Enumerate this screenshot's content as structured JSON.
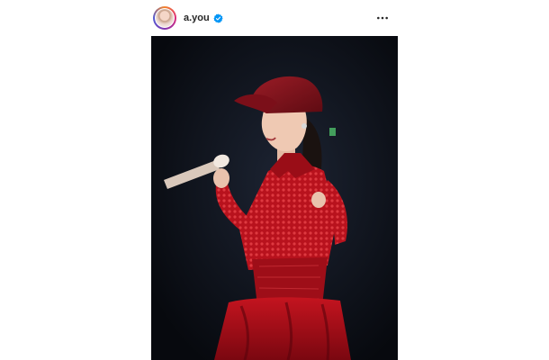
{
  "post": {
    "username": "a.you",
    "verified": true,
    "avatar_icon": "profile-avatar",
    "menu_icon": "more-dots-icon"
  },
  "photo": {
    "subject": "concert-performance-photo"
  },
  "colors": {
    "verified_blue": "#0095f6",
    "outfit_red": "#b3101c",
    "stage_dark": "#0d1017"
  }
}
